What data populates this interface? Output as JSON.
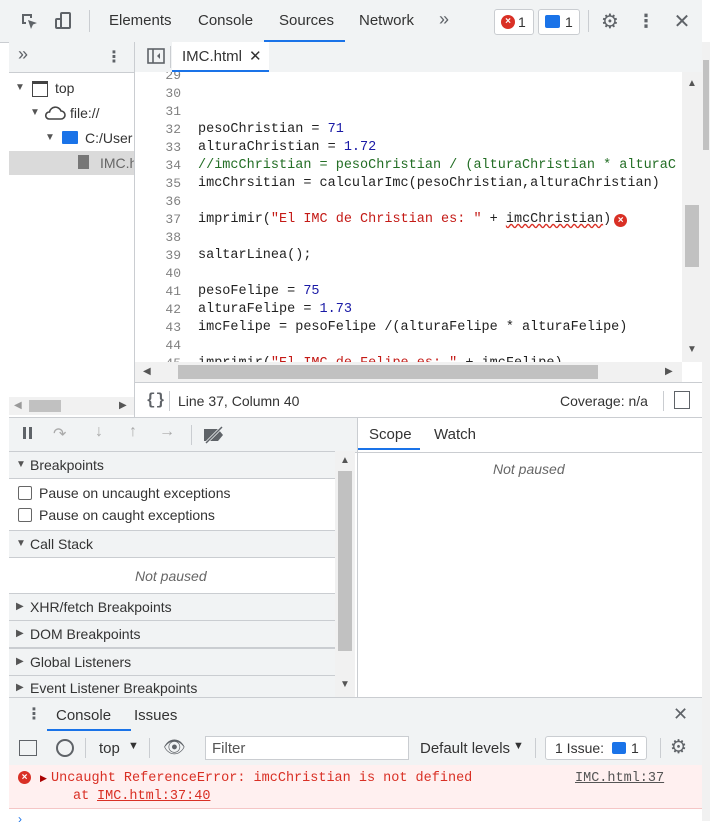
{
  "toolbar": {
    "tabs": [
      "Elements",
      "Console",
      "Sources",
      "Network"
    ],
    "active_tab": "Sources",
    "more_tabs": "»",
    "error_count": "1",
    "message_count": "1"
  },
  "navigator": {
    "more": "»",
    "tree": [
      {
        "label": "top"
      },
      {
        "label": "file://"
      },
      {
        "label": "C:/User"
      },
      {
        "label": "IMC.h"
      }
    ]
  },
  "editor": {
    "file_tab": "IMC.html",
    "lines": [
      {
        "n": "29",
        "t": ""
      },
      {
        "n": "30",
        "t": ""
      },
      {
        "n": "31",
        "t": ""
      },
      {
        "n": "32",
        "t": "pesoChristian = ",
        "v": "71"
      },
      {
        "n": "33",
        "t": "alturaChristian = ",
        "v": "1.72"
      },
      {
        "n": "34",
        "c": "//imcChristian = pesoChristian / (alturaChristian * alturaC"
      },
      {
        "n": "35",
        "t": "imcChrsitian = calcularImc(pesoChristian,alturaChristian)"
      },
      {
        "n": "36",
        "t": ""
      },
      {
        "n": "37",
        "t": "imprimir(",
        "s": "\"El IMC de Christian es: \"",
        "t2": " + ",
        "err": "imcChristian",
        ")": ")"
      },
      {
        "n": "38",
        "t": ""
      },
      {
        "n": "39",
        "t": "saltarLinea();"
      },
      {
        "n": "40",
        "t": ""
      },
      {
        "n": "41",
        "t": "pesoFelipe = ",
        "v": "75"
      },
      {
        "n": "42",
        "t": "alturaFelipe = ",
        "v": "1.73"
      },
      {
        "n": "43",
        "t": "imcFelipe = pesoFelipe /(alturaFelipe * alturaFelipe)"
      },
      {
        "n": "44",
        "t": ""
      },
      {
        "n": "45",
        "t": "imprimir(",
        "s": "\"El IMC de Felipe es: \"",
        "t2": " + imcFelipe)"
      }
    ]
  },
  "status": {
    "braces": "{}",
    "position": "Line 37, Column 40",
    "coverage": "Coverage: n/a"
  },
  "debugger": {
    "breakpoints_title": "Breakpoints",
    "pause_uncaught": "Pause on uncaught exceptions",
    "pause_caught": "Pause on caught exceptions",
    "call_stack_title": "Call Stack",
    "not_paused": "Not paused",
    "sections": [
      "XHR/fetch Breakpoints",
      "DOM Breakpoints",
      "Global Listeners",
      "Event Listener Breakpoints"
    ]
  },
  "scope": {
    "tabs": [
      "Scope",
      "Watch"
    ],
    "not_paused": "Not paused"
  },
  "drawer": {
    "tabs": [
      "Console",
      "Issues"
    ],
    "context": "top",
    "filter_placeholder": "Filter",
    "levels": "Default levels",
    "issues": "1 Issue:",
    "issues_count": "1",
    "error_message": "Uncaught ReferenceError: imcChristian is not defined",
    "error_source": "IMC.html:37",
    "error_at_prefix": "at ",
    "error_at_link": "IMC.html:37:40"
  },
  "colors": {
    "accent": "#1a73e8",
    "error": "#d93025",
    "error_bg": "#fff0f0"
  }
}
